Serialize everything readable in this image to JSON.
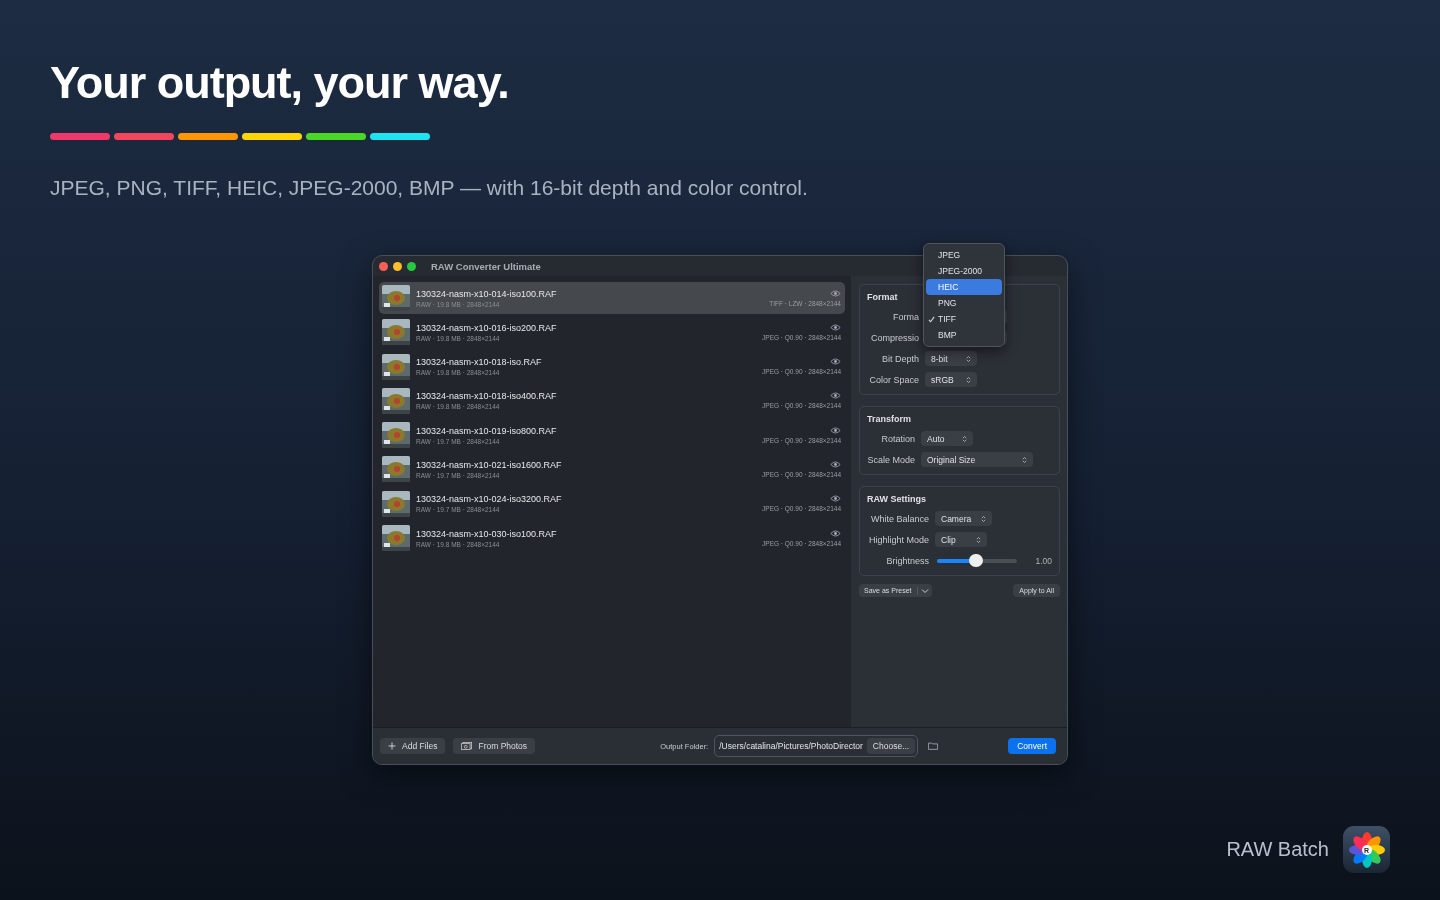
{
  "hero": {
    "title": "Your output, your way.",
    "stripes": [
      {
        "color": "#f0386b"
      },
      {
        "color": "#f5455c"
      },
      {
        "color": "#ff9500"
      },
      {
        "color": "#ffd60a"
      },
      {
        "color": "#4cd625"
      },
      {
        "color": "#1ee3f0"
      }
    ],
    "subtitle": "JPEG, PNG, TIFF, HEIC, JPEG-2000, BMP — with 16-bit depth and color control."
  },
  "window": {
    "title": "RAW Converter Ultimate"
  },
  "files": [
    {
      "name": "130324-nasm-x10-014-iso100.RAF",
      "info": "RAW · 19.8 MB · 2848×2144",
      "output": "TIFF · LZW · 2848×2144",
      "selected": true
    },
    {
      "name": "130324-nasm-x10-016-iso200.RAF",
      "info": "RAW · 19.8 MB · 2848×2144",
      "output": "JPEG · Q0.90 · 2848×2144",
      "selected": false
    },
    {
      "name": "130324-nasm-x10-018-iso.RAF",
      "info": "RAW · 19.8 MB · 2848×2144",
      "output": "JPEG · Q0.90 · 2848×2144",
      "selected": false
    },
    {
      "name": "130324-nasm-x10-018-iso400.RAF",
      "info": "RAW · 19.8 MB · 2848×2144",
      "output": "JPEG · Q0.90 · 2848×2144",
      "selected": false
    },
    {
      "name": "130324-nasm-x10-019-iso800.RAF",
      "info": "RAW · 19.7 MB · 2848×2144",
      "output": "JPEG · Q0.90 · 2848×2144",
      "selected": false
    },
    {
      "name": "130324-nasm-x10-021-iso1600.RAF",
      "info": "RAW · 19.7 MB · 2848×2144",
      "output": "JPEG · Q0.90 · 2848×2144",
      "selected": false
    },
    {
      "name": "130324-nasm-x10-024-iso3200.RAF",
      "info": "RAW · 19.7 MB · 2848×2144",
      "output": "JPEG · Q0.90 · 2848×2144",
      "selected": false
    },
    {
      "name": "130324-nasm-x10-030-iso100.RAF",
      "info": "RAW · 19.8 MB · 2848×2144",
      "output": "JPEG · Q0.90 · 2848×2144",
      "selected": false
    }
  ],
  "sections": [
    {
      "title": "Format",
      "rows": [
        {
          "kind": "covered",
          "label": "Forma"
        },
        {
          "kind": "covered",
          "label": "Compressio"
        },
        {
          "kind": "popup",
          "label": "Bit Depth",
          "value": "8-bit"
        },
        {
          "kind": "popup",
          "label": "Color Space",
          "value": "sRGB"
        }
      ]
    },
    {
      "title": "Transform",
      "rows": [
        {
          "kind": "popup",
          "label": "Rotation",
          "value": "Auto"
        },
        {
          "kind": "popup",
          "label": "Scale Mode",
          "value": "Original Size"
        }
      ]
    },
    {
      "title": "RAW Settings",
      "rows": [
        {
          "kind": "popup",
          "label": "White Balance",
          "value": "Camera"
        },
        {
          "kind": "popup",
          "label": "Highlight Mode",
          "value": "Clip"
        },
        {
          "kind": "slider",
          "label": "Brightness",
          "level": 0.5,
          "reading": "1.00"
        }
      ]
    }
  ],
  "preset_button": "Save as Preset",
  "apply_button": "Apply to All",
  "format_menu": [
    {
      "label": "JPEG",
      "highlighted": false,
      "checked": false
    },
    {
      "label": "JPEG-2000",
      "highlighted": false,
      "checked": false
    },
    {
      "label": "HEIC",
      "highlighted": true,
      "checked": false
    },
    {
      "label": "PNG",
      "highlighted": false,
      "checked": false
    },
    {
      "label": "TIFF",
      "highlighted": false,
      "checked": true
    },
    {
      "label": "BMP",
      "highlighted": false,
      "checked": false
    }
  ],
  "bottom_bar": {
    "add_files": "Add Files",
    "from_photos": "From Photos",
    "output_label": "Output Folder:",
    "output_path": "/Users/catalina/Pictures/PhotoDirector",
    "choose": "Choose...",
    "convert": "Convert"
  },
  "brand": {
    "name": "RAW Batch",
    "icon_letter": "R"
  }
}
